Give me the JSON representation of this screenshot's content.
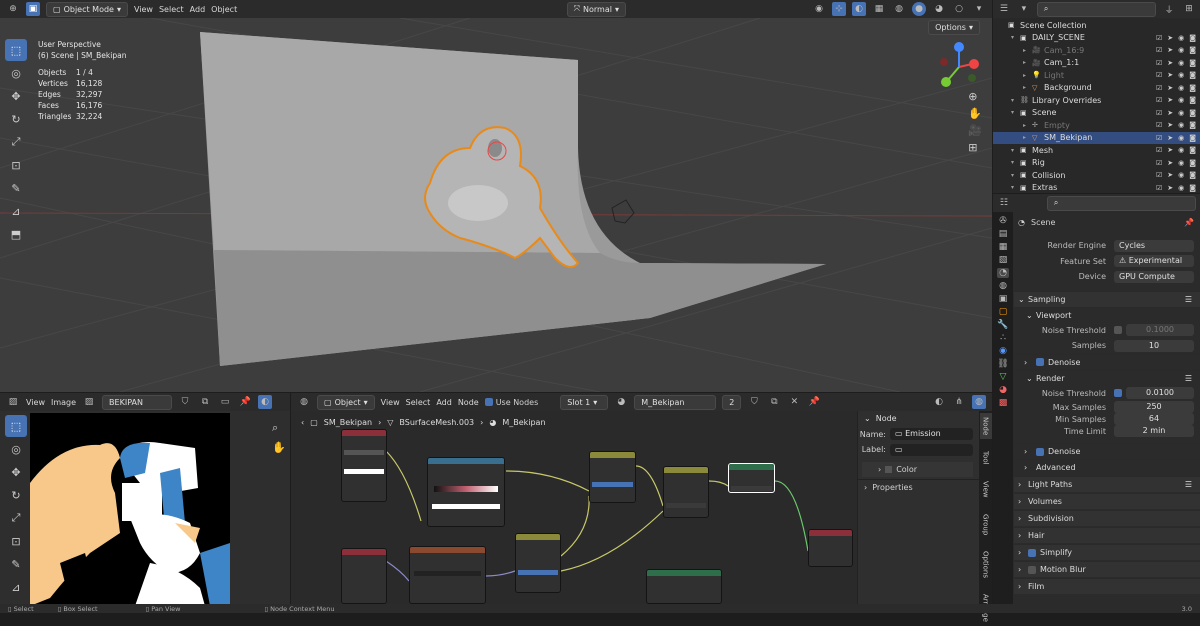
{
  "viewport": {
    "mode": "Object Mode",
    "menus": [
      "View",
      "Select",
      "Add",
      "Object"
    ],
    "orientation": "Normal",
    "options": "Options",
    "info": {
      "perspective": "User Perspective",
      "context": "(6) Scene | SM_Bekipan"
    },
    "stats": [
      {
        "k": "Objects",
        "v": "1 / 4"
      },
      {
        "k": "Vertices",
        "v": "16,128"
      },
      {
        "k": "Edges",
        "v": "32,297"
      },
      {
        "k": "Faces",
        "v": "16,176"
      },
      {
        "k": "Triangles",
        "v": "32,224"
      }
    ]
  },
  "outliner": {
    "rows": [
      {
        "label": "Scene Collection",
        "indent": 0,
        "icon": "collection-icon",
        "dim": false,
        "sel": false
      },
      {
        "label": "DAILY_SCENE",
        "indent": 1,
        "icon": "collection-icon",
        "dim": false,
        "sel": false
      },
      {
        "label": "Cam_16:9",
        "indent": 2,
        "icon": "camera-icon",
        "dim": true,
        "sel": false
      },
      {
        "label": "Cam_1:1",
        "indent": 2,
        "icon": "camera-icon",
        "dim": false,
        "sel": false
      },
      {
        "label": "Light",
        "indent": 2,
        "icon": "light-icon",
        "dim": true,
        "sel": false
      },
      {
        "label": "Background",
        "indent": 2,
        "icon": "mesh-icon",
        "dim": false,
        "sel": false
      },
      {
        "label": "Library Overrides",
        "indent": 1,
        "icon": "link-icon",
        "dim": false,
        "sel": false
      },
      {
        "label": "Scene",
        "indent": 1,
        "icon": "collection-icon",
        "dim": false,
        "sel": false
      },
      {
        "label": "Empty",
        "indent": 2,
        "icon": "empty-icon",
        "dim": true,
        "sel": false
      },
      {
        "label": "SM_Bekipan",
        "indent": 2,
        "icon": "mesh-icon",
        "dim": false,
        "sel": true
      },
      {
        "label": "Mesh",
        "indent": 1,
        "icon": "collection-icon",
        "dim": false,
        "sel": false
      },
      {
        "label": "Rig",
        "indent": 1,
        "icon": "collection-icon",
        "dim": false,
        "sel": false
      },
      {
        "label": "Collision",
        "indent": 1,
        "icon": "collection-icon",
        "dim": false,
        "sel": false
      },
      {
        "label": "Extras",
        "indent": 1,
        "icon": "collection-icon",
        "dim": false,
        "sel": false
      }
    ]
  },
  "properties": {
    "context": "Scene",
    "render_engine": {
      "label": "Render Engine",
      "value": "Cycles"
    },
    "feature_set": {
      "label": "Feature Set",
      "value": "Experimental"
    },
    "device": {
      "label": "Device",
      "value": "GPU Compute"
    },
    "sampling": "Sampling",
    "viewport_sub": "Viewport",
    "vp_noise": {
      "label": "Noise Threshold",
      "value": "0.1000"
    },
    "vp_samples": {
      "label": "Samples",
      "value": "10"
    },
    "denoise": "Denoise",
    "render_sub": "Render",
    "r_noise": {
      "label": "Noise Threshold",
      "value": "0.0100"
    },
    "max_samples": {
      "label": "Max Samples",
      "value": "250"
    },
    "min_samples": {
      "label": "Min Samples",
      "value": "64"
    },
    "time_limit": {
      "label": "Time Limit",
      "value": "2 min"
    },
    "denoise2": "Denoise",
    "advanced": "Advanced",
    "panels": [
      "Light Paths",
      "Volumes",
      "Subdivision",
      "Hair",
      "Simplify",
      "Motion Blur",
      "Film"
    ]
  },
  "image_editor": {
    "menus": [
      "View",
      "Image"
    ],
    "image_name": "BEKIPAN"
  },
  "node_editor": {
    "type": "Object",
    "menus": [
      "View",
      "Select",
      "Add",
      "Node"
    ],
    "use_nodes": "Use Nodes",
    "slot": "Slot 1",
    "material": "M_Bekipan",
    "users": "2",
    "breadcrumb": [
      "SM_Bekipan",
      "BSurfaceMesh.003",
      "M_Bekipan"
    ],
    "sidebar": {
      "title": "Node",
      "name_label": "Name:",
      "name_value": "Emission",
      "label_label": "Label:",
      "color": "Color",
      "properties": "Properties"
    },
    "tabs": [
      "Node",
      "Tool",
      "View",
      "Group",
      "Options",
      "Arrange"
    ]
  },
  "status": {
    "items": [
      "Select",
      "Box Select",
      "Pan View",
      "Node Context Menu"
    ],
    "version": "3.0"
  }
}
